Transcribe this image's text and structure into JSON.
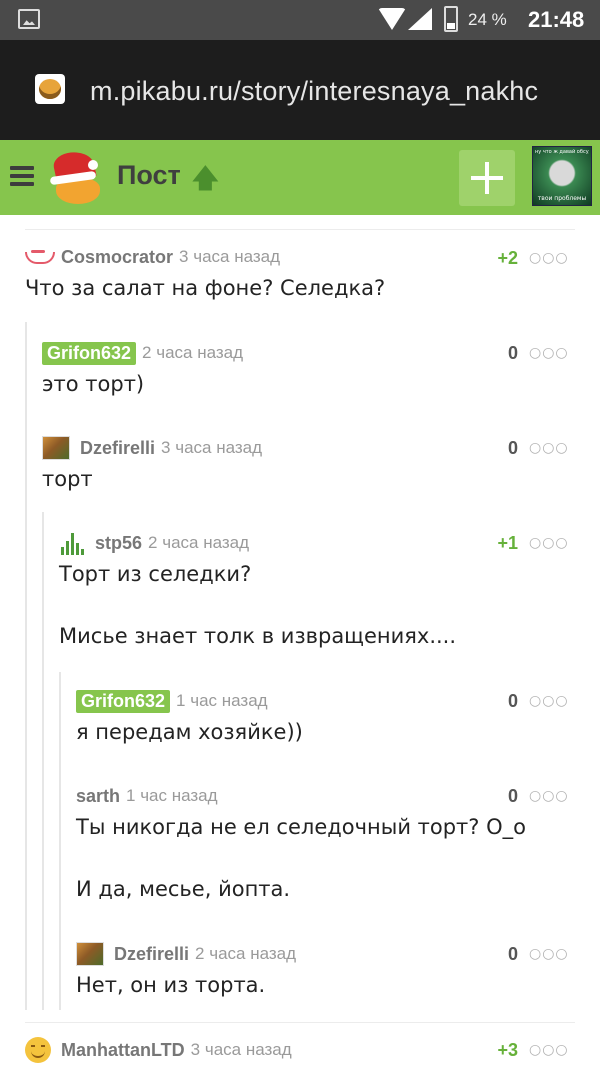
{
  "status_bar": {
    "battery": "24 %",
    "time": "21:48",
    "icons": [
      "image-icon",
      "wifi-icon",
      "signal-icon",
      "battery-icon"
    ]
  },
  "browser": {
    "url": "m.pikabu.ru/story/interesnaya_nakhc",
    "site_icon": "pikabu-favicon"
  },
  "header": {
    "title": "Пост",
    "title_arrow": "🡅",
    "menu_icon": "hamburger-icon",
    "add_button_icon": "plus-icon",
    "user_avatar_caption_top": "ну что ж давай обсудим",
    "user_avatar_caption_bottom": "твои проблемы",
    "colors": {
      "header_bg": "#86c54d",
      "positive": "#66b13a"
    }
  },
  "comments": [
    {
      "author": "Cosmocrator",
      "time": "3 часа назад",
      "rating": "+2",
      "text": "Что за салат на фоне? Селедка?",
      "avatar": "lips-avatar",
      "tagged": false
    },
    {
      "author": "Grifon632",
      "time": "2 часа назад",
      "rating": "0",
      "text": "это торт)",
      "avatar": "",
      "tagged": true
    },
    {
      "author": "Dzefirelli",
      "time": "3 часа назад",
      "rating": "0",
      "text": "торт",
      "avatar": "photo-avatar",
      "tagged": false
    },
    {
      "author": "stp56",
      "time": "2 часа назад",
      "rating": "+1",
      "text": "Торт из селедки?",
      "text2": "Мисье знает толк в извращениях....",
      "avatar": "bars-avatar",
      "tagged": false
    },
    {
      "author": "Grifon632",
      "time": "1 час назад",
      "rating": "0",
      "text": "я передам хозяйке))",
      "avatar": "",
      "tagged": true
    },
    {
      "author": "sarth",
      "time": "1 час назад",
      "rating": "0",
      "text": "Ты никогда не ел селедочный торт? О_о",
      "text2": "И да, месье, йопта.",
      "avatar": "",
      "tagged": false
    },
    {
      "author": "Dzefirelli",
      "time": "2 часа назад",
      "rating": "0",
      "text": "Нет, он из торта.",
      "avatar": "photo-avatar",
      "tagged": false
    },
    {
      "author": "ManhattanLTD",
      "time": "3 часа назад",
      "rating": "+3",
      "text": "",
      "avatar": "smile-avatar",
      "tagged": false
    }
  ],
  "more_glyph": "○○○"
}
